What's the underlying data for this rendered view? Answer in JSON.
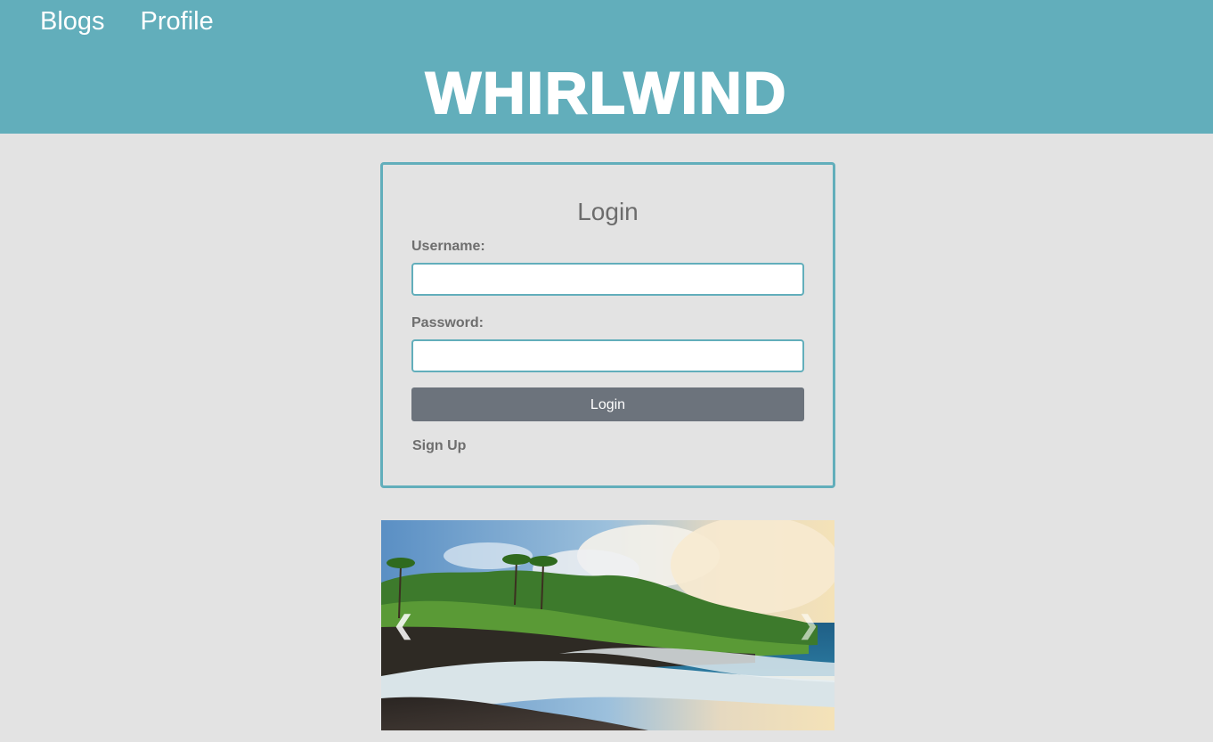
{
  "nav": {
    "items": [
      {
        "label": "Blogs"
      },
      {
        "label": "Profile"
      }
    ]
  },
  "brand": {
    "title": "WHIRLWIND"
  },
  "login": {
    "title": "Login",
    "username_label": "Username:",
    "username_value": "",
    "password_label": "Password:",
    "password_value": "",
    "submit_label": "Login",
    "signup_label": "Sign Up"
  },
  "carousel": {
    "prev_icon": "chevron-left-icon",
    "next_icon": "chevron-right-icon",
    "prev_glyph": "❮",
    "next_glyph": "❯"
  },
  "colors": {
    "header": "#62aebb",
    "background": "#e3e3e3",
    "button": "#6c737c",
    "text_muted": "#6e6e6e"
  }
}
